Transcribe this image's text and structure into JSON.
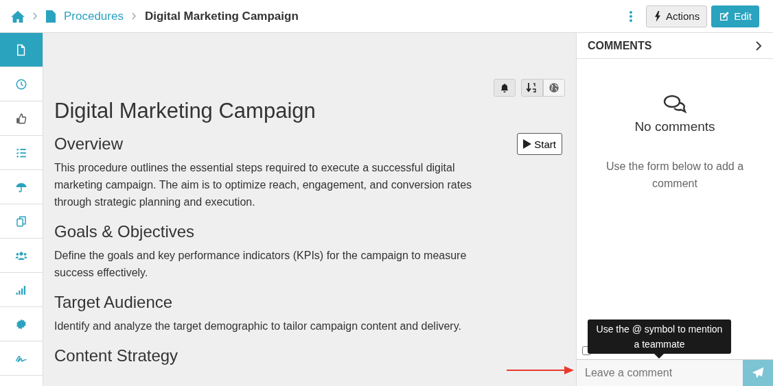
{
  "breadcrumb": {
    "items": [
      {
        "label": "Procedures"
      }
    ],
    "current": "Digital Marketing Campaign"
  },
  "header_buttons": [
    {
      "kind": "actions",
      "label": "Actions"
    },
    {
      "kind": "edit",
      "label": "Edit"
    }
  ],
  "sidebar": {
    "items": [
      {
        "selected": true
      },
      {
        "selected": false
      },
      {
        "selected": false
      },
      {
        "selected": false
      },
      {
        "selected": false
      },
      {
        "selected": false
      },
      {
        "selected": false
      },
      {
        "selected": false
      },
      {
        "selected": false
      },
      {
        "selected": false
      }
    ]
  },
  "document": {
    "title": "Digital Marketing Campaign",
    "start_button": "Start",
    "sections": [
      {
        "heading": "Overview",
        "text": "This procedure outlines the essential steps required to execute a successful digital marketing campaign. The aim is to optimize reach, engagement, and conversion rates through strategic planning and execution."
      },
      {
        "heading": "Goals & Objectives",
        "text": "Define the goals and key performance indicators (KPIs) for the campaign to measure success effectively."
      },
      {
        "heading": "Target Audience",
        "text": "Identify and analyze the target demographic to tailor campaign content and delivery."
      },
      {
        "heading": "Content Strategy"
      }
    ]
  },
  "comments": {
    "title": "COMMENTS",
    "empty_title": "No comments",
    "empty_hint": "Use the form below to add a comment",
    "hide_deleted": {
      "checked": false
    },
    "tooltip": "Use the @ symbol to mention a teammate",
    "input": {
      "placeholder": "Leave a comment"
    }
  }
}
